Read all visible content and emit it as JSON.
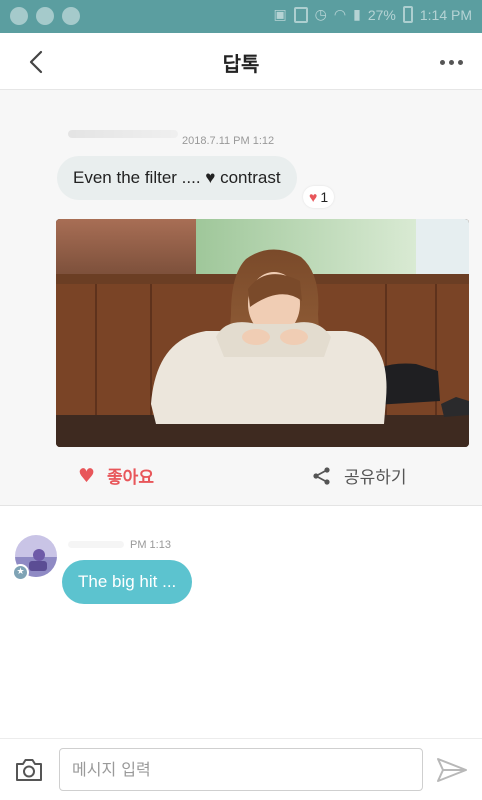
{
  "status_bar": {
    "time": "1:14 PM",
    "battery": "27%"
  },
  "header": {
    "title": "답톡"
  },
  "messages": {
    "first": {
      "timestamp": "2018.7.11 PM 1:12",
      "text": "Even the filter .... ♥ contrast",
      "reaction_count": "1"
    },
    "second": {
      "timestamp": "PM 1:13",
      "text": "The big hit ..."
    }
  },
  "actions": {
    "like_label": "좋아요",
    "share_label": "공유하기"
  },
  "input": {
    "placeholder": "메시지 입력"
  },
  "colors": {
    "status_bar": "#5b9ea0",
    "accent_like": "#e8565a",
    "bubble_outgoing": "#5cc3cf",
    "bubble_incoming": "#e9eeee"
  }
}
